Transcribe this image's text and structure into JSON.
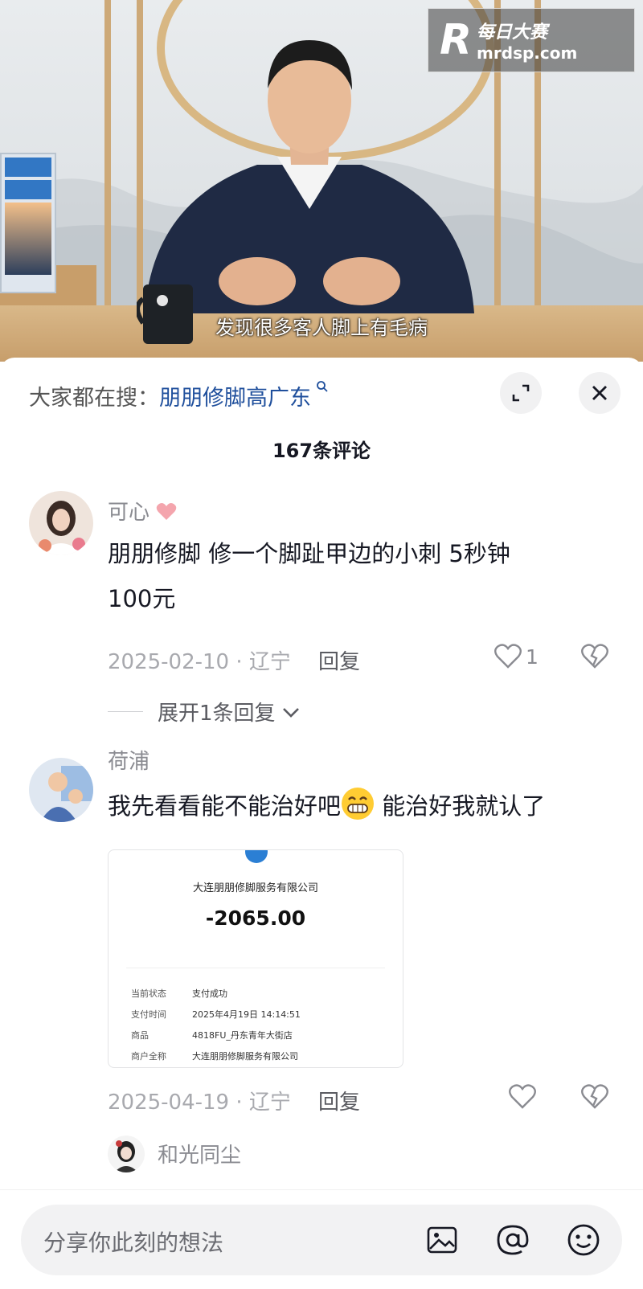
{
  "video": {
    "subtitle": "发现很多客人脚上有毛病",
    "watermark": {
      "logo": "R",
      "name": "每日大赛",
      "url": "mrdsp.com"
    }
  },
  "sheet": {
    "search_prefix": "大家都在搜：",
    "search_term": "朋朋修脚高广东",
    "comment_count": "167条评论"
  },
  "comments": [
    {
      "user": "可心",
      "text_line1": "朋朋修脚 修一个脚趾甲边的小刺  5秒钟",
      "text_line2": "100元",
      "meta": "2025-02-10 · 辽宁",
      "reply": "回复",
      "likes": "1",
      "expand": "展开1条回复"
    },
    {
      "user": "荷浦",
      "text_before_emoji": "我先看看能不能治好吧",
      "text_after_emoji": " 能治好我就认了",
      "meta": "2025-04-19 · 辽宁",
      "reply": "回复",
      "receipt": {
        "merchant": "大连朋朋修脚服务有限公司",
        "amount": "-2065.00",
        "rows": [
          {
            "k": "当前状态",
            "v": "支付成功"
          },
          {
            "k": "支付时间",
            "v": "2025年4月19日 14:14:51"
          },
          {
            "k": "商品",
            "v": "4818FU_丹东青年大街店"
          },
          {
            "k": "商户全称",
            "v": "大连朋朋修脚服务有限公司"
          }
        ]
      }
    },
    {
      "user": "和光同尘"
    }
  ],
  "input": {
    "placeholder": "分享你此刻的想法"
  },
  "colors": {
    "link": "#1f4f9c",
    "heart": "#f4a5ad"
  }
}
